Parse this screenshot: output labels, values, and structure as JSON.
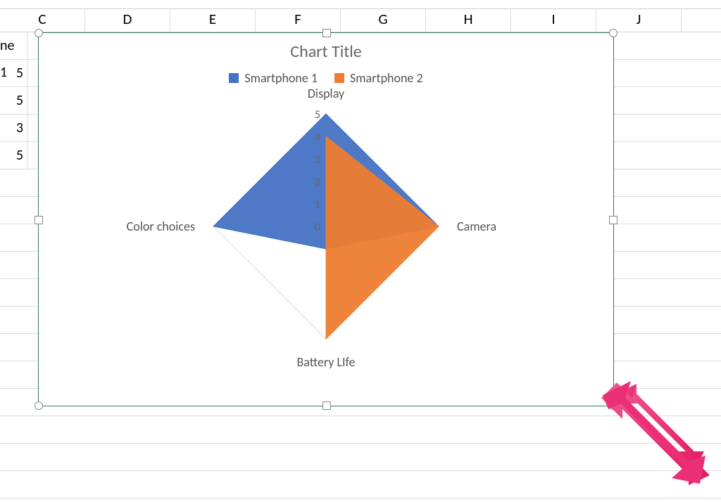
{
  "columns": [
    "C",
    "D",
    "E",
    "F",
    "G",
    "H",
    "I",
    "J"
  ],
  "visible_cells": {
    "partial_header": "ne 1",
    "r1": "5",
    "r2": "5",
    "r3": "3",
    "r4": "5"
  },
  "chart": {
    "title": "Chart Title",
    "legend": {
      "s1": "Smartphone 1",
      "s2": "Smartphone 2"
    },
    "axes": {
      "top": "Display",
      "right": "Camera",
      "bottom": "Battery LIfe",
      "left": "Color choices",
      "ticks": [
        "5",
        "4",
        "3",
        "2",
        "1",
        "0"
      ]
    }
  },
  "chart_data": {
    "type": "radar",
    "categories": [
      "Display",
      "Camera",
      "Battery LIfe",
      "Color choices"
    ],
    "series": [
      {
        "name": "Smartphone 1",
        "color": "#4472c4",
        "values": [
          5,
          5,
          1,
          5
        ]
      },
      {
        "name": "Smartphone 2",
        "color": "#ed7d31",
        "values": [
          4,
          5,
          5,
          0
        ]
      }
    ],
    "title": "Chart Title",
    "rlim": [
      0,
      5
    ],
    "rticks": [
      0,
      1,
      2,
      3,
      4,
      5
    ]
  },
  "colors": {
    "series1": "#4472c4",
    "series2": "#ed7d31",
    "selection": "#2e7d5a",
    "arrow": "#e63973"
  }
}
